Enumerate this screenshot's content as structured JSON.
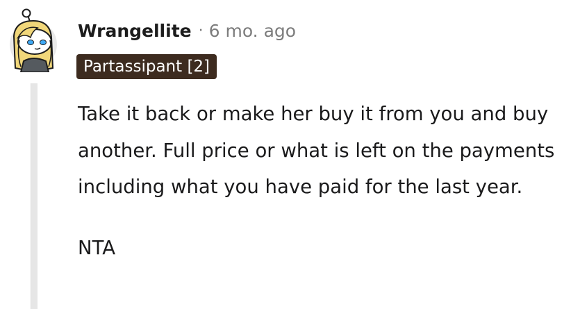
{
  "comment": {
    "author": "Wrangellite",
    "separator": "·",
    "timestamp": "6 mo. ago",
    "flair": "Partassipant [2]",
    "paragraphs": [
      "Take it back or make her buy it from you and buy another. Full price or what is left on the payments including what you have paid for the last year.",
      "NTA"
    ],
    "avatar_icon": "snoo-avatar-blonde-icon"
  },
  "colors": {
    "flair_background": "#3d2b1f",
    "flair_text": "#ffffff",
    "muted_text": "#7c7c7c",
    "thread_line": "#e6e6e6"
  }
}
